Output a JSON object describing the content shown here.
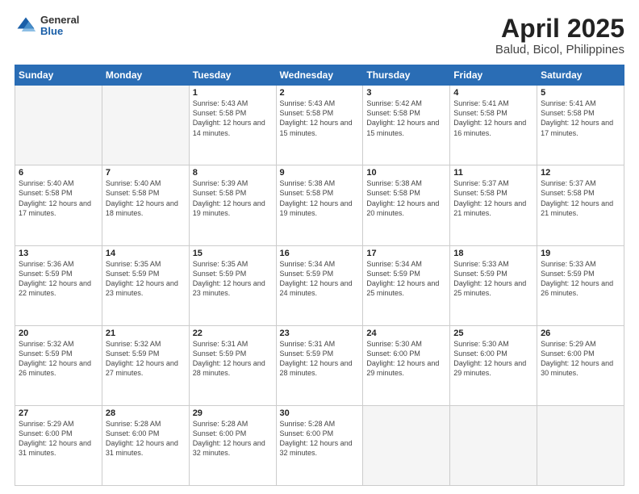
{
  "header": {
    "logo": {
      "general": "General",
      "blue": "Blue"
    },
    "title": "April 2025",
    "subtitle": "Balud, Bicol, Philippines"
  },
  "weekdays": [
    "Sunday",
    "Monday",
    "Tuesday",
    "Wednesday",
    "Thursday",
    "Friday",
    "Saturday"
  ],
  "weeks": [
    [
      {
        "day": "",
        "info": ""
      },
      {
        "day": "",
        "info": ""
      },
      {
        "day": "1",
        "info": "Sunrise: 5:43 AM\nSunset: 5:58 PM\nDaylight: 12 hours\nand 14 minutes."
      },
      {
        "day": "2",
        "info": "Sunrise: 5:43 AM\nSunset: 5:58 PM\nDaylight: 12 hours\nand 15 minutes."
      },
      {
        "day": "3",
        "info": "Sunrise: 5:42 AM\nSunset: 5:58 PM\nDaylight: 12 hours\nand 15 minutes."
      },
      {
        "day": "4",
        "info": "Sunrise: 5:41 AM\nSunset: 5:58 PM\nDaylight: 12 hours\nand 16 minutes."
      },
      {
        "day": "5",
        "info": "Sunrise: 5:41 AM\nSunset: 5:58 PM\nDaylight: 12 hours\nand 17 minutes."
      }
    ],
    [
      {
        "day": "6",
        "info": "Sunrise: 5:40 AM\nSunset: 5:58 PM\nDaylight: 12 hours\nand 17 minutes."
      },
      {
        "day": "7",
        "info": "Sunrise: 5:40 AM\nSunset: 5:58 PM\nDaylight: 12 hours\nand 18 minutes."
      },
      {
        "day": "8",
        "info": "Sunrise: 5:39 AM\nSunset: 5:58 PM\nDaylight: 12 hours\nand 19 minutes."
      },
      {
        "day": "9",
        "info": "Sunrise: 5:38 AM\nSunset: 5:58 PM\nDaylight: 12 hours\nand 19 minutes."
      },
      {
        "day": "10",
        "info": "Sunrise: 5:38 AM\nSunset: 5:58 PM\nDaylight: 12 hours\nand 20 minutes."
      },
      {
        "day": "11",
        "info": "Sunrise: 5:37 AM\nSunset: 5:58 PM\nDaylight: 12 hours\nand 21 minutes."
      },
      {
        "day": "12",
        "info": "Sunrise: 5:37 AM\nSunset: 5:58 PM\nDaylight: 12 hours\nand 21 minutes."
      }
    ],
    [
      {
        "day": "13",
        "info": "Sunrise: 5:36 AM\nSunset: 5:59 PM\nDaylight: 12 hours\nand 22 minutes."
      },
      {
        "day": "14",
        "info": "Sunrise: 5:35 AM\nSunset: 5:59 PM\nDaylight: 12 hours\nand 23 minutes."
      },
      {
        "day": "15",
        "info": "Sunrise: 5:35 AM\nSunset: 5:59 PM\nDaylight: 12 hours\nand 23 minutes."
      },
      {
        "day": "16",
        "info": "Sunrise: 5:34 AM\nSunset: 5:59 PM\nDaylight: 12 hours\nand 24 minutes."
      },
      {
        "day": "17",
        "info": "Sunrise: 5:34 AM\nSunset: 5:59 PM\nDaylight: 12 hours\nand 25 minutes."
      },
      {
        "day": "18",
        "info": "Sunrise: 5:33 AM\nSunset: 5:59 PM\nDaylight: 12 hours\nand 25 minutes."
      },
      {
        "day": "19",
        "info": "Sunrise: 5:33 AM\nSunset: 5:59 PM\nDaylight: 12 hours\nand 26 minutes."
      }
    ],
    [
      {
        "day": "20",
        "info": "Sunrise: 5:32 AM\nSunset: 5:59 PM\nDaylight: 12 hours\nand 26 minutes."
      },
      {
        "day": "21",
        "info": "Sunrise: 5:32 AM\nSunset: 5:59 PM\nDaylight: 12 hours\nand 27 minutes."
      },
      {
        "day": "22",
        "info": "Sunrise: 5:31 AM\nSunset: 5:59 PM\nDaylight: 12 hours\nand 28 minutes."
      },
      {
        "day": "23",
        "info": "Sunrise: 5:31 AM\nSunset: 5:59 PM\nDaylight: 12 hours\nand 28 minutes."
      },
      {
        "day": "24",
        "info": "Sunrise: 5:30 AM\nSunset: 6:00 PM\nDaylight: 12 hours\nand 29 minutes."
      },
      {
        "day": "25",
        "info": "Sunrise: 5:30 AM\nSunset: 6:00 PM\nDaylight: 12 hours\nand 29 minutes."
      },
      {
        "day": "26",
        "info": "Sunrise: 5:29 AM\nSunset: 6:00 PM\nDaylight: 12 hours\nand 30 minutes."
      }
    ],
    [
      {
        "day": "27",
        "info": "Sunrise: 5:29 AM\nSunset: 6:00 PM\nDaylight: 12 hours\nand 31 minutes."
      },
      {
        "day": "28",
        "info": "Sunrise: 5:28 AM\nSunset: 6:00 PM\nDaylight: 12 hours\nand 31 minutes."
      },
      {
        "day": "29",
        "info": "Sunrise: 5:28 AM\nSunset: 6:00 PM\nDaylight: 12 hours\nand 32 minutes."
      },
      {
        "day": "30",
        "info": "Sunrise: 5:28 AM\nSunset: 6:00 PM\nDaylight: 12 hours\nand 32 minutes."
      },
      {
        "day": "",
        "info": ""
      },
      {
        "day": "",
        "info": ""
      },
      {
        "day": "",
        "info": ""
      }
    ]
  ]
}
